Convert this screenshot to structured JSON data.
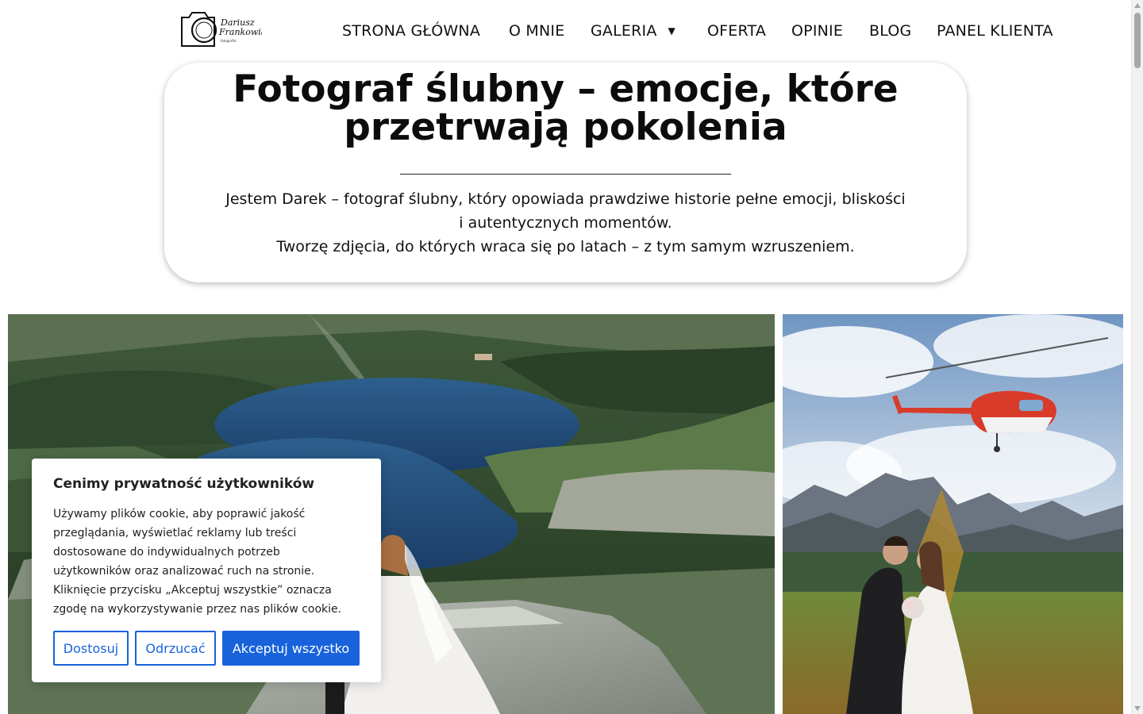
{
  "header": {
    "logo": {
      "line1": "Dariusz",
      "line2": "Frankowiak",
      "line3": "fotografia"
    },
    "nav": [
      {
        "label": "STRONA GŁÓWNA"
      },
      {
        "label": "O MNIE"
      },
      {
        "label": "GALERIA",
        "icon": "caret-down-icon"
      },
      {
        "label": "OFERTA"
      },
      {
        "label": "OPINIE"
      },
      {
        "label": "BLOG"
      },
      {
        "label": "PANEL KLIENTA"
      }
    ]
  },
  "hero": {
    "title_line1": "Fotograf ślubny – emocje, które",
    "title_line2": "przetrwają pokolenia",
    "text_line1": "Jestem Darek – fotograf ślubny, który opowiada prawdziwe historie pełne emocji, bliskości",
    "text_line2": "i autentycznych momentów.",
    "text_line3": "Tworzę zdjęcia, do których wraca się po latach – z tym samym wzruszeniem."
  },
  "gallery": {
    "photos": [
      {
        "subject": "wedding-couple-mountain-lake"
      },
      {
        "subject": "wedding-couple-helicopter-mountains"
      }
    ]
  },
  "cookie": {
    "title": "Cenimy prywatność użytkowników",
    "text_lines": [
      "Używamy plików cookie, aby poprawić jakość",
      "przeglądania, wyświetlać reklamy lub treści",
      "dostosowane do indywidualnych potrzeb",
      "użytkowników oraz analizować ruch na stronie.",
      "Kliknięcie przycisku „Akceptuj wszystkie” oznacza",
      "zgodę na wykorzystywanie przez nas plików cookie."
    ],
    "buttons": {
      "customize": "Dostosuj",
      "reject": "Odrzucać",
      "accept": "Akceptuj wszystko"
    }
  },
  "colors": {
    "accent": "#1863dc",
    "text": "#111111",
    "background": "#ffffff"
  }
}
